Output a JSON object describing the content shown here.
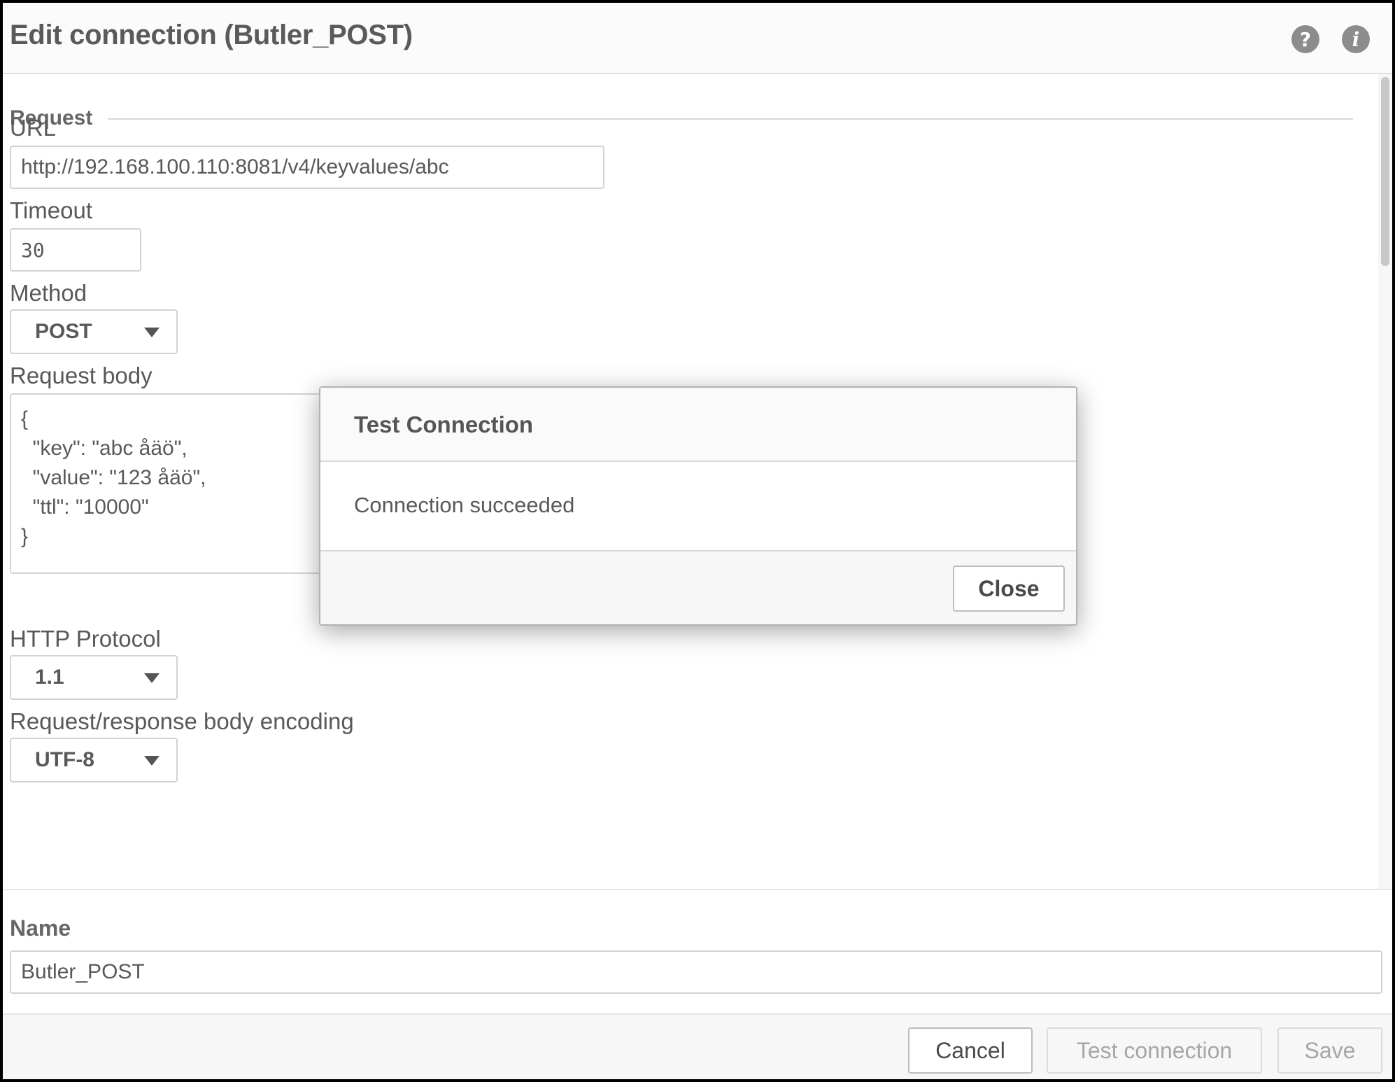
{
  "header": {
    "title": "Edit connection (Butler_POST)",
    "help_icon": "question-circle-icon",
    "info_icon": "info-circle-icon"
  },
  "request": {
    "section_label": "Request",
    "url": {
      "label": "URL",
      "value": "http://192.168.100.110:8081/v4/keyvalues/abc"
    },
    "timeout": {
      "label": "Timeout",
      "value": "30"
    },
    "method": {
      "label": "Method",
      "selected": "POST"
    },
    "body": {
      "label": "Request body",
      "value": "{\n  \"key\": \"abc åäö\",\n  \"value\": \"123 åäö\",\n  \"ttl\": \"10000\"\n}"
    },
    "http_protocol": {
      "label": "HTTP Protocol",
      "selected": "1.1"
    },
    "encoding": {
      "label": "Request/response body encoding",
      "selected": "UTF-8"
    }
  },
  "name": {
    "label": "Name",
    "value": "Butler_POST"
  },
  "footer": {
    "cancel_label": "Cancel",
    "test_label": "Test connection",
    "save_label": "Save"
  },
  "modal": {
    "title": "Test Connection",
    "message": "Connection succeeded",
    "close_label": "Close"
  },
  "colors": {
    "text": "#595959",
    "border": "#d3d3d3",
    "header_bg": "#fbfbfb",
    "disabled_text": "#a6a6a6"
  }
}
